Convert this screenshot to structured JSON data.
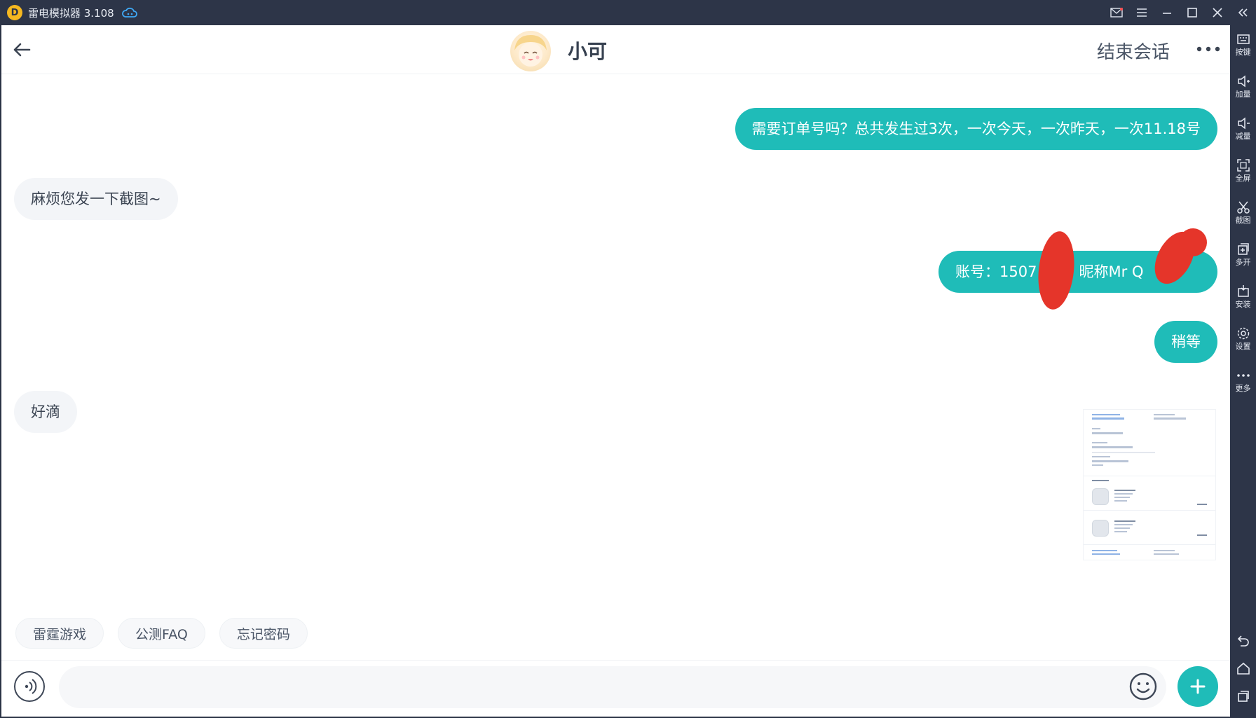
{
  "titlebar": {
    "app_title": "雷电模拟器 3.108",
    "logo_glyph": "D"
  },
  "rail": {
    "items": [
      {
        "label": "按键",
        "icon": "keyboard-icon"
      },
      {
        "label": "加量",
        "icon": "volume-up-icon"
      },
      {
        "label": "减量",
        "icon": "volume-down-icon"
      },
      {
        "label": "全屏",
        "icon": "fullscreen-icon"
      },
      {
        "label": "截图",
        "icon": "scissors-icon"
      },
      {
        "label": "多开",
        "icon": "multi-instance-icon"
      },
      {
        "label": "安装",
        "icon": "apk-install-icon"
      },
      {
        "label": "设置",
        "icon": "gear-icon"
      },
      {
        "label": "更多",
        "icon": "more-icon"
      }
    ]
  },
  "chat": {
    "contact_name": "小可",
    "end_session_label": "结束会话",
    "messages": [
      {
        "side": "out",
        "text": "需要订单号吗？总共发生过3次，一次今天，一次昨天，一次11.18号"
      },
      {
        "side": "in",
        "text": "麻烦您发一下截图~"
      },
      {
        "side": "out",
        "text": "账号：1507    622. 昵称Mr     Q"
      },
      {
        "side": "out",
        "text": "稍等"
      },
      {
        "side": "in",
        "text": "好滴"
      }
    ]
  },
  "quick_replies": [
    "雷霆游戏",
    "公测FAQ",
    "忘记密码"
  ],
  "input": {
    "placeholder": ""
  },
  "colors": {
    "accent": "#1fbcb8",
    "titlebar_bg": "#2d3548",
    "redaction": "#e5352a"
  }
}
